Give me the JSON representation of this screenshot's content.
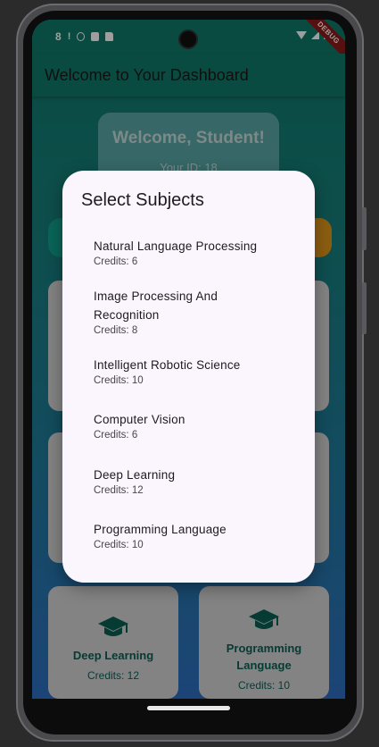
{
  "status_bar": {
    "time": "8",
    "icons": [
      "sim-alert-icon",
      "shield-icon",
      "a-box-icon",
      "sd-card-icon"
    ],
    "right_icons": [
      "wifi-icon",
      "signal-icon",
      "battery-icon"
    ],
    "debug_label": "DEBUG"
  },
  "app_bar": {
    "title": "Welcome to Your Dashboard"
  },
  "welcome_card": {
    "title": "Welcome, Student!",
    "id_label": "Your ID: 18"
  },
  "background_cards": [
    {
      "name": "Deep Learning",
      "credits": "Credits: 12",
      "icon": "graduation-cap-icon"
    },
    {
      "name": "Programming Language",
      "credits": "Credits: 10",
      "icon": "graduation-cap-icon"
    }
  ],
  "dialog": {
    "title": "Select Subjects",
    "items": [
      {
        "name": "Natural Language Processing",
        "credits": "Credits: 6"
      },
      {
        "name": "Image Processing And Recognition",
        "credits": "Credits: 8"
      },
      {
        "name": "Intelligent Robotic Science",
        "credits": "Credits: 10"
      },
      {
        "name": "Computer Vision",
        "credits": "Credits: 6"
      },
      {
        "name": "Deep Learning",
        "credits": "Credits: 12"
      },
      {
        "name": "Programming Language",
        "credits": "Credits: 10"
      }
    ]
  },
  "colors": {
    "primary": "#0f7a6a",
    "accent_orange": "#e0961a",
    "card_text": "#0b5f55",
    "dialog_bg": "#fbf6fd"
  }
}
